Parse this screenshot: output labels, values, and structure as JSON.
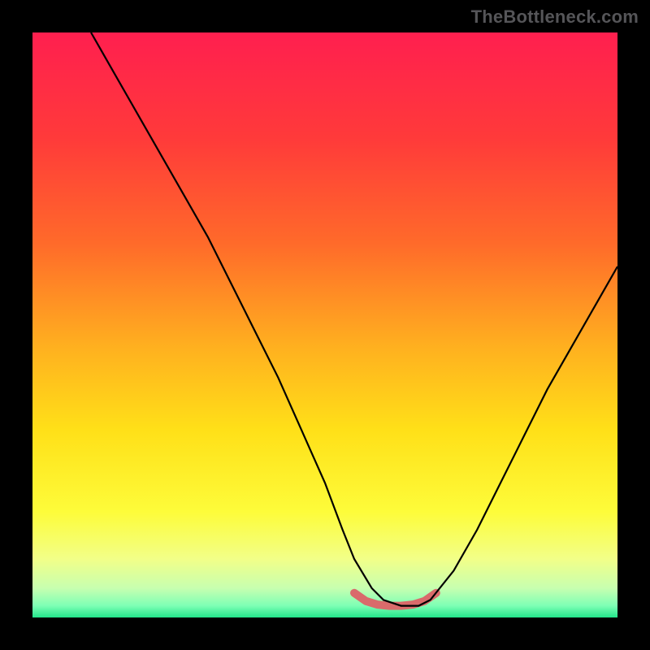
{
  "watermark": "TheBottleneck.com",
  "gradient_stops": [
    {
      "offset": 0.0,
      "color": "#ff1f4f"
    },
    {
      "offset": 0.18,
      "color": "#ff3a3a"
    },
    {
      "offset": 0.36,
      "color": "#ff6a2a"
    },
    {
      "offset": 0.54,
      "color": "#ffb11f"
    },
    {
      "offset": 0.68,
      "color": "#ffe018"
    },
    {
      "offset": 0.82,
      "color": "#fdfc3a"
    },
    {
      "offset": 0.9,
      "color": "#f2ff88"
    },
    {
      "offset": 0.95,
      "color": "#c7ffb0"
    },
    {
      "offset": 0.98,
      "color": "#7dffb5"
    },
    {
      "offset": 1.0,
      "color": "#23e58a"
    }
  ],
  "chart_data": {
    "type": "line",
    "title": "",
    "xlabel": "",
    "ylabel": "",
    "xlim": [
      0,
      100
    ],
    "ylim": [
      0,
      100
    ],
    "grid": false,
    "series": [
      {
        "name": "profile",
        "stroke": "#000000",
        "width": 2.2,
        "x": [
          10,
          14,
          18,
          22,
          26,
          30,
          34,
          38,
          42,
          46,
          50,
          53,
          55,
          58,
          60,
          63,
          66,
          68,
          72,
          76,
          80,
          84,
          88,
          92,
          96,
          100
        ],
        "y": [
          100,
          93,
          86,
          79,
          72,
          65,
          57,
          49,
          41,
          32,
          23,
          15,
          10,
          5,
          3,
          2,
          2,
          3,
          8,
          15,
          23,
          31,
          39,
          46,
          53,
          60
        ]
      },
      {
        "name": "optimal-band",
        "stroke": "#d96b6b",
        "width": 10,
        "linecap": "round",
        "x": [
          55,
          57,
          59,
          61,
          63,
          65,
          67,
          69
        ],
        "y": [
          4.2,
          2.8,
          2.2,
          2.0,
          2.0,
          2.2,
          2.8,
          4.2
        ]
      }
    ]
  }
}
